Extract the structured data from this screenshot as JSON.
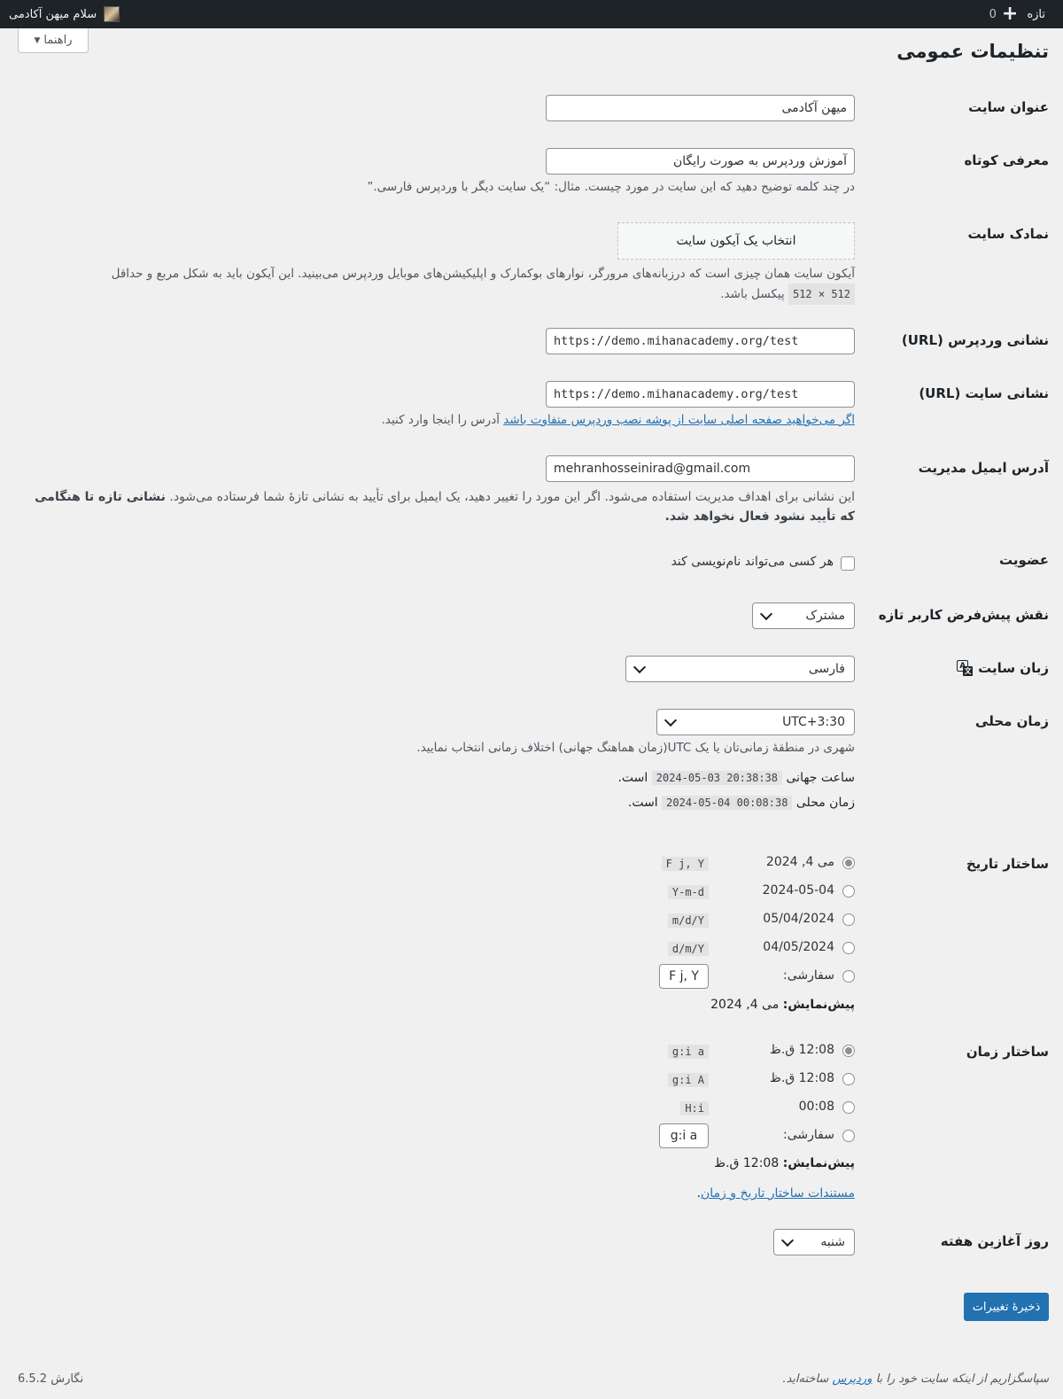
{
  "adminbar": {
    "user_greeting": "سلام میهن آکادمی",
    "new_label": "تازه",
    "comment_count": "0"
  },
  "help_tab": {
    "label": "راهنما"
  },
  "page": {
    "title": "تنظیمات عمومی"
  },
  "site_title": {
    "label": "عنوان سایت",
    "value": "میهن آکادمی"
  },
  "tagline": {
    "label": "معرفی کوتاه",
    "value": "آموزش وردپرس به صورت رایگان",
    "description": "در چند کلمه توضیح دهید که این سایت در مورد چیست. مثال: “یک سایت دیگر با وردپرس فارسی.”"
  },
  "site_icon": {
    "label": "نمادک سایت",
    "button": "انتخاب یک آیکون سایت",
    "description_1": "آیکون سایت همان چیزی است که درزبانه‌های مرورگر، نوارهای بوکمارک و اپلیکیشن‌های موبایل وردپرس می‌بینید. این آیکون باید به شکل مربع و حداقل",
    "size_code": "512 × 512",
    "description_2": "پیکسل باشد."
  },
  "wp_url": {
    "label": "نشانی وردپرس (URL)",
    "value": "https://demo.mihanacademy.org/test"
  },
  "site_url": {
    "label": "نشانی سایت (URL)",
    "value": "https://demo.mihanacademy.org/test",
    "link_text": "اگر می‌خواهید صفحه اصلی سایت از پوشه نصب وردپرس متفاوت باشد",
    "desc_rest": " آدرس را اینجا وارد کنید."
  },
  "admin_email": {
    "label": "آدرس ایمیل مدیریت",
    "value": "mehranhosseinirad@gmail.com",
    "description": "این نشانی برای اهداف مدیریت استفاده می‌شود. اگر این مورد را تغییر دهید، یک ایمیل برای تأیید به نشانی تازهٔ شما فرستاده می‌شود.",
    "description_bold_1": "نشانی تازه تا هنگامی",
    "description_bold_2": "که تأیید نشود فعال نخواهد شد."
  },
  "membership": {
    "label": "عضویت",
    "checkbox_label": "هر کسی می‌تواند نام‌نویسی کند",
    "checked": false
  },
  "default_role": {
    "label": "نقش پیش‌فرض کاربر تازه",
    "value": "مشترک"
  },
  "site_language": {
    "label": "زبان سایت",
    "value": "فارسی"
  },
  "timezone": {
    "label": "زمان محلی",
    "value": "UTC+3:30",
    "description": "شهری در منطقهٔ زمانی‌تان یا یک UTC(زمان هماهنگ جهانی) اختلاف زمانی انتخاب نمایید.",
    "utc_prefix": "ساعت جهانی",
    "utc_value": "2024-05-03 20:38:38",
    "local_prefix": "زمان محلی",
    "local_value": "2024-05-04 00:08:38",
    "suffix": "است."
  },
  "date_format": {
    "label": "ساختار تاریخ",
    "options": [
      {
        "text": "می 4, 2024",
        "code": "F j, Y",
        "selected": true
      },
      {
        "text": "2024-05-04",
        "code": "Y-m-d",
        "selected": false
      },
      {
        "text": "05/04/2024",
        "code": "m/d/Y",
        "selected": false
      },
      {
        "text": "04/05/2024",
        "code": "d/m/Y",
        "selected": false
      }
    ],
    "custom_label": "سفارشی:",
    "custom_value": "F j, Y",
    "preview_label": "پیش‌نمایش:",
    "preview_value": "می 4, 2024"
  },
  "time_format": {
    "label": "ساختار زمان",
    "options": [
      {
        "text": "12:08 ق.ظ",
        "code": "g:i a",
        "selected": true
      },
      {
        "text": "12:08 ق.ظ",
        "code": "g:i A",
        "selected": false
      },
      {
        "text": "00:08",
        "code": "H:i",
        "selected": false
      }
    ],
    "custom_label": "سفارشی:",
    "custom_value": "g:i a",
    "preview_label": "پیش‌نمایش:",
    "preview_value": "12:08 ق.ظ",
    "docs_link": "مستندات ساختار تاریخ و زمان"
  },
  "week_start": {
    "label": "روز آغازین هفته",
    "value": "شنبه"
  },
  "save_button": "ذخیرهٔ تغییرات",
  "footer": {
    "thanks_prefix": "سپاسگزاریم از اینکه سایت خود را با ",
    "thanks_link": "وردپرس",
    "thanks_suffix": " ساخته‌اید.",
    "version": "نگارش 6.5.2"
  }
}
